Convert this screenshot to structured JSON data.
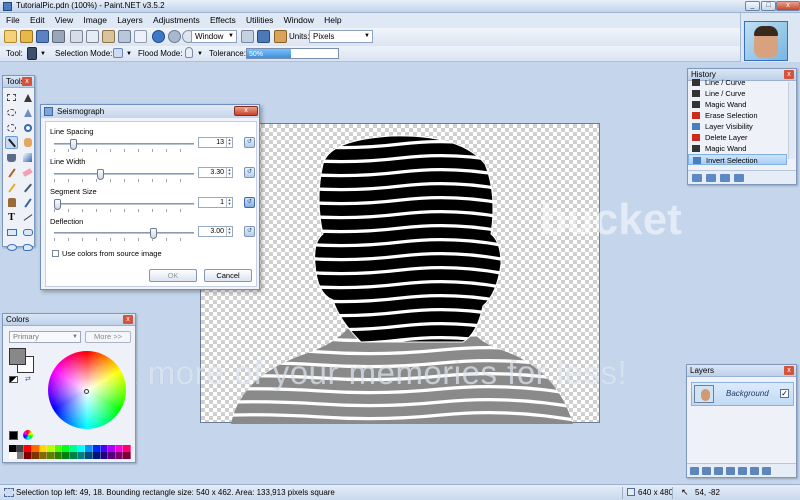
{
  "window": {
    "title": "TutorialPic.pdn (100%) - Paint.NET v3.5.2",
    "min": "_",
    "max": "□",
    "close": "x"
  },
  "menu": [
    "File",
    "Edit",
    "View",
    "Image",
    "Layers",
    "Adjustments",
    "Effects",
    "Utilities",
    "Window",
    "Help"
  ],
  "toolbar": {
    "zoom_combo": "Window",
    "units_label": "Units:",
    "units_value": "Pixels",
    "tool_label": "Tool:",
    "selection_mode_label": "Selection Mode:",
    "flood_mode_label": "Flood Mode:",
    "tolerance_label": "Tolerance:",
    "tolerance_value": "50%",
    "tolerance_fraction": 0.48
  },
  "tools_panel": {
    "title": "Tools",
    "close": "x"
  },
  "dialog": {
    "title": "Seismograph",
    "close": "x",
    "fields": [
      {
        "label": "Line Spacing",
        "value": "13",
        "fraction": 0.12
      },
      {
        "label": "Line Width",
        "value": "3.30",
        "fraction": 0.32
      },
      {
        "label": "Segment Size",
        "value": "1",
        "fraction": 0.0
      },
      {
        "label": "Deflection",
        "value": "3.00",
        "fraction": 0.72
      }
    ],
    "checkbox_label": "Use colors from source image",
    "ok": "OK",
    "cancel": "Cancel"
  },
  "history": {
    "title": "History",
    "close": "x",
    "items": [
      {
        "label": "Line / Curve",
        "icon": "line-curve-icon",
        "color": "#333333"
      },
      {
        "label": "Line / Curve",
        "icon": "line-curve-icon",
        "color": "#333333"
      },
      {
        "label": "Magic Wand",
        "icon": "magic-wand-icon",
        "color": "#333333"
      },
      {
        "label": "Erase Selection",
        "icon": "erase-icon",
        "color": "#cc2a1a"
      },
      {
        "label": "Layer Visibility",
        "icon": "layer-visibility-icon",
        "color": "#4a7ec2"
      },
      {
        "label": "Delete Layer",
        "icon": "delete-icon",
        "color": "#cc2a1a"
      },
      {
        "label": "Magic Wand",
        "icon": "magic-wand-icon",
        "color": "#333333"
      },
      {
        "label": "Invert Selection",
        "icon": "invert-selection-icon",
        "color": "#4a7ec2",
        "selected": true
      }
    ]
  },
  "colors": {
    "title": "Colors",
    "close": "x",
    "primary_select": "Primary",
    "more_button": "More >>",
    "primary_color": "#888888",
    "secondary_color": "#ffffff"
  },
  "layers": {
    "title": "Layers",
    "close": "x",
    "layer_name": "Background",
    "visible_check": "✓"
  },
  "watermark": {
    "text": "Protect more of your memories for less!",
    "logo_text": "bucket"
  },
  "status": {
    "left": "Selection top left: 49, 18. Bounding rectangle size: 540 x 462. Area: 133,913 pixels square",
    "image_size": "640 x 480",
    "cursor": "54, -82"
  },
  "palette": [
    "#000000",
    "#404040",
    "#ff0000",
    "#ff6a00",
    "#ffd800",
    "#b6ff00",
    "#4cff00",
    "#00ff21",
    "#00ff90",
    "#00ffff",
    "#0094ff",
    "#0026ff",
    "#4800ff",
    "#b200ff",
    "#ff00dc",
    "#ff006e",
    "#ffffff",
    "#808080",
    "#7f0000",
    "#7f3300",
    "#7f6a00",
    "#5b7f00",
    "#267f00",
    "#007f0e",
    "#007f46",
    "#007f7f",
    "#004a7f",
    "#00137f",
    "#21007f",
    "#57007f",
    "#7f006e",
    "#7f0037"
  ]
}
